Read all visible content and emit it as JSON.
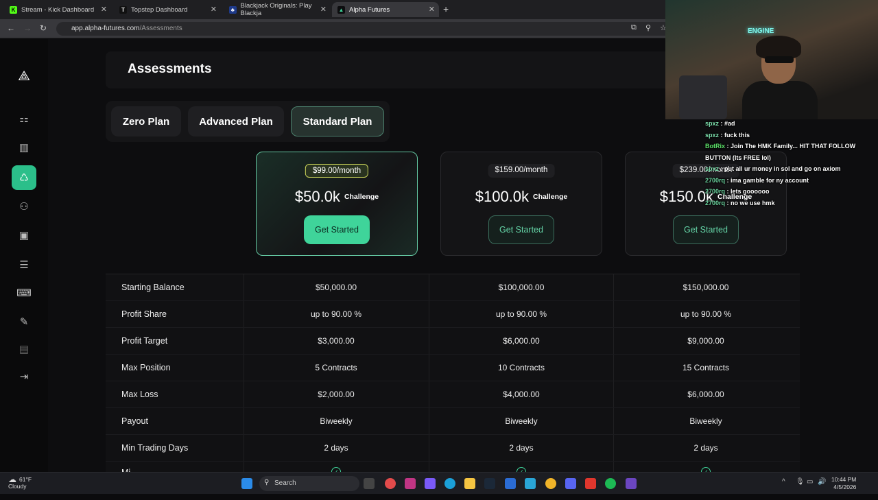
{
  "browser": {
    "tabs": [
      {
        "title": "Stream - Kick Dashboard",
        "icon": "K",
        "color": "#53fc18"
      },
      {
        "title": "Topstep Dashboard",
        "icon": "T",
        "color": "#ffffff"
      },
      {
        "title": "Blackjack Originals: Play Blackja",
        "icon": "♣",
        "color": "#3b82f6"
      },
      {
        "title": "Alpha Futures",
        "icon": "▲",
        "color": "#3fd49a"
      }
    ],
    "url_domain": "app.alpha-futures.com",
    "url_path": "/Assessments"
  },
  "page": {
    "title": "Assessments",
    "plan_tabs": [
      "Zero Plan",
      "Advanced Plan",
      "Standard Plan"
    ],
    "selected_plan": "Standard Plan",
    "cards": [
      {
        "price": "$99.00/month",
        "amount": "$50.0k",
        "type": "Challenge",
        "cta": "Get Started"
      },
      {
        "price": "$159.00/month",
        "amount": "$100.0k",
        "type": "Challenge",
        "cta": "Get Started"
      },
      {
        "price": "$239.00/month",
        "amount": "$150.0k",
        "type": "Challenge",
        "cta": "Get Started"
      }
    ],
    "table": [
      {
        "label": "Starting Balance",
        "values": [
          "$50,000.00",
          "$100,000.00",
          "$150,000.00"
        ]
      },
      {
        "label": "Profit Share",
        "values": [
          "up to 90.00 %",
          "up to 90.00 %",
          "up to 90.00 %"
        ]
      },
      {
        "label": "Profit Target",
        "values": [
          "$3,000.00",
          "$6,000.00",
          "$9,000.00"
        ]
      },
      {
        "label": "Max Position",
        "values": [
          "5 Contracts",
          "10 Contracts",
          "15 Contracts"
        ]
      },
      {
        "label": "Max Loss",
        "values": [
          "$2,000.00",
          "$4,000.00",
          "$6,000.00"
        ]
      },
      {
        "label": "Payout",
        "values": [
          "Biweekly",
          "Biweekly",
          "Biweekly"
        ]
      },
      {
        "label": "Min Trading Days",
        "values": [
          "2 days",
          "2 days",
          "2 days"
        ]
      }
    ],
    "partial_row_label": "Mi",
    "accent": "#3fd49a"
  },
  "stream": {
    "neon_sign": "ENGINE",
    "chat": [
      {
        "user": "spxz",
        "msg": "#ad"
      },
      {
        "user": "spxz",
        "msg": "fuck this"
      },
      {
        "user": "BotRix",
        "msg": "Join The HMK Family... HIT THAT FOLLOW BUTTON (Its FREE lol)"
      },
      {
        "user": "spxz",
        "msg": "put all ur money in sol and go on axiom"
      },
      {
        "user": "2700rq",
        "msg": "ima gamble for ny account"
      },
      {
        "user": "2700rq",
        "msg": "lets goooooo"
      },
      {
        "user": "2700rq",
        "msg": "no we use hmk"
      }
    ]
  },
  "taskbar": {
    "weather_temp": "61°F",
    "weather_desc": "Cloudy",
    "search_placeholder": "Search",
    "time": "10:44 PM",
    "date": "4/5/2026"
  }
}
